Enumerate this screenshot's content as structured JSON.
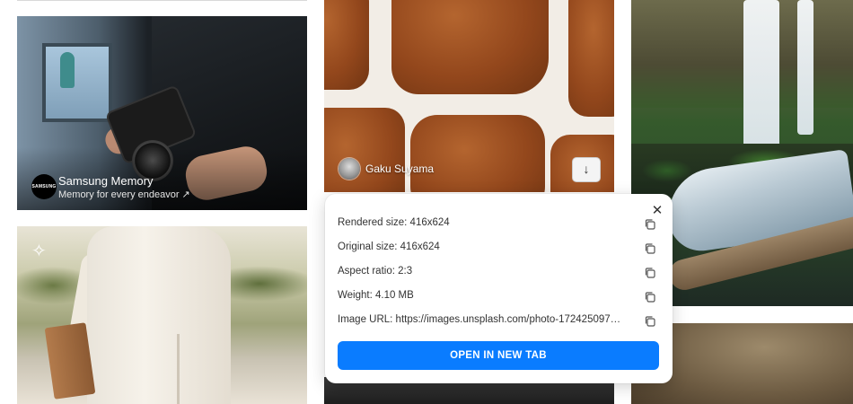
{
  "ad_card": {
    "logo_text": "SAMSUNG\nMemory",
    "title": "Samsung Memory",
    "subtitle": "Memory for every endeavor ↗"
  },
  "giraffe_card": {
    "author": "Gaku Suyama",
    "download_icon": "download-arrow-icon"
  },
  "info_popup": {
    "rows": [
      {
        "label": "Rendered size: 416x624"
      },
      {
        "label": "Original size: 416x624"
      },
      {
        "label": "Aspect ratio: 2:3"
      },
      {
        "label": "Weight: 4.10 MB"
      },
      {
        "label": "Image URL: https://images.unsplash.com/photo-1724250973924..."
      }
    ],
    "button_label": "OPEN IN NEW TAB",
    "close_icon": "close-icon",
    "copy_icon": "copy-icon",
    "accent": "#0a7cff"
  },
  "dress_card": {
    "badge_icon": "ai-sparkle-icon"
  }
}
